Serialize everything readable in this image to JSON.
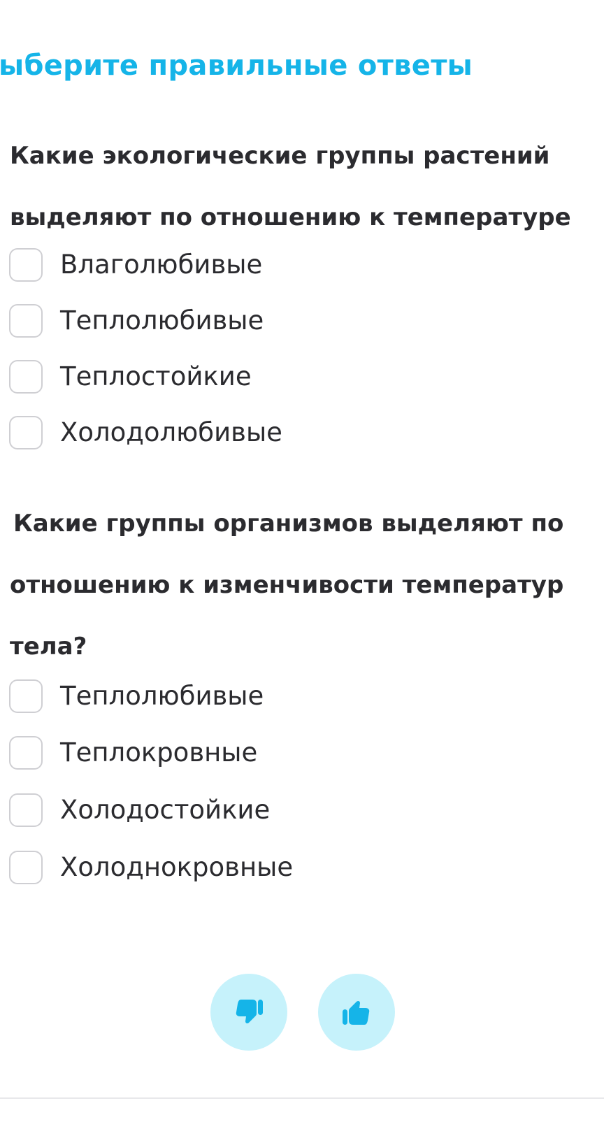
{
  "page": {
    "heading": "ыберите правильные ответы"
  },
  "questions": [
    {
      "lines": [
        "Какие экологические группы растений",
        "выделяют по отношению к температуре"
      ],
      "options": [
        "Влаголюбивые",
        "Теплолюбивые",
        "Теплостойкие",
        "Холодолюбивые"
      ]
    },
    {
      "lines": [
        "Какие группы организмов выделяют по",
        "отношению к изменчивости температур",
        "тела?"
      ],
      "options": [
        "Теплолюбивые",
        "Теплокровные",
        "Холодостойкие",
        "Холоднокровные"
      ]
    }
  ],
  "feedback": {
    "dislike_icon": "thumbs-down-icon",
    "like_icon": "thumbs-up-icon"
  },
  "colors": {
    "accent": "#15b4e8",
    "button_bg": "#c6f2fb",
    "text": "#2b2b2f",
    "checkbox_border": "#cfcfd3"
  }
}
